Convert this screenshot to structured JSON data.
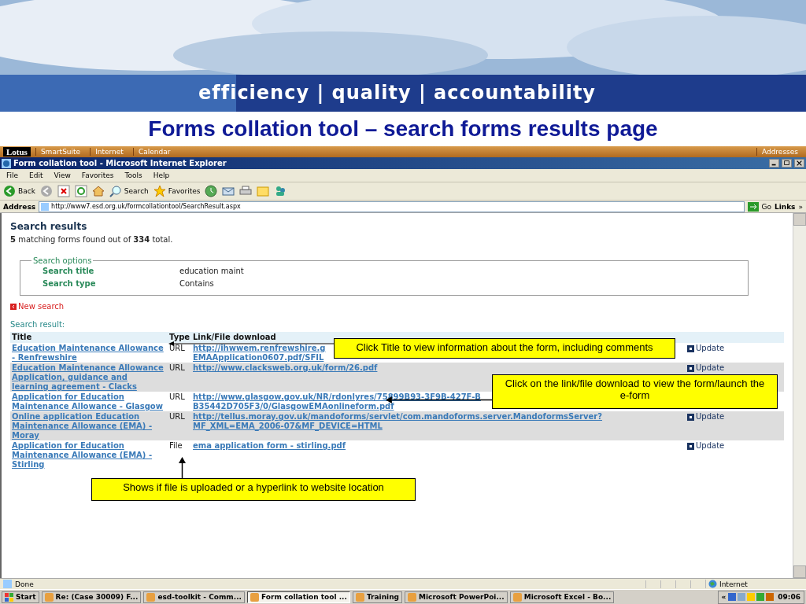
{
  "slide": {
    "tagline": "efficiency | quality | accountability",
    "title": "Forms collation tool – search forms results page"
  },
  "lotus_bar": {
    "brand": "Lotus",
    "items": [
      "SmartSuite",
      "Internet",
      "Calendar",
      "Addresses"
    ]
  },
  "window": {
    "title": "Form collation tool - Microsoft Internet Explorer"
  },
  "menu": [
    "File",
    "Edit",
    "View",
    "Favorites",
    "Tools",
    "Help"
  ],
  "toolbar": {
    "back": "Back",
    "search": "Search",
    "favorites": "Favorites"
  },
  "address_bar": {
    "label": "Address",
    "url": "http://www7.esd.org.uk/formcollationtool/SearchResult.aspx",
    "go": "Go",
    "links": "Links",
    "more": "»"
  },
  "page": {
    "heading": "Search results",
    "summary": "**5** matching forms found out of **334** total.",
    "options": {
      "legend": "Search options",
      "rows": [
        {
          "label": "Search title",
          "value": "education maint"
        },
        {
          "label": "Search type",
          "value": "Contains"
        }
      ]
    },
    "new_search": "New search",
    "result_label": "Search result:",
    "columns": [
      "Title",
      "Type",
      "Link/File download"
    ],
    "rows": [
      {
        "title": "Education Maintenance Allowance - Renfrewshire",
        "type": "URL",
        "link": [
          "http://ihwwem.renfrewshire.g",
          "EMAApplication0607.pdf/SFIL"
        ],
        "update": "Update"
      },
      {
        "title": "Education Maintenance Allowance Application, guidance and learning agreement - Clacks",
        "type": "URL",
        "link": [
          "http://www.clacksweb.org.uk/form/26.pdf"
        ],
        "update": "Update"
      },
      {
        "title": "Application for Education Maintenance Allowance - Glasgow",
        "type": "URL",
        "link": [
          "http://www.glasgow.gov.uk/NR/rdonlyres/75899B93-3F9B-427F-B",
          "B35442D705F3/0/GlasgowEMAonlineform.pdf"
        ],
        "update": ""
      },
      {
        "title": "Online application Education Maintenance Allowance (EMA) - Moray",
        "type": "URL",
        "link": [
          "http://tellus.moray.gov.uk/mandoforms/servlet/com.mandoforms.server.MandoformsServer?",
          "MF_XML=EMA_2006-07&MF_DEVICE=HTML"
        ],
        "update": "Update"
      },
      {
        "title": "Application for Education Maintenance Allowance (EMA) - Stirling",
        "type": "File",
        "link": [
          "ema application form - stirling.pdf"
        ],
        "update": "Update"
      }
    ],
    "callouts": [
      "Click Title to view information about the form, including comments",
      "Click on the link/file download to view the form/launch the e-form",
      "Shows if file is uploaded or a hyperlink to website location"
    ]
  },
  "status_bar": {
    "text": "Done",
    "zone": "Internet"
  },
  "taskbar": {
    "start": "Start",
    "items": [
      {
        "label": "Re: (Case 30009) F...",
        "selected": false
      },
      {
        "label": "esd-toolkit - Comm...",
        "selected": false
      },
      {
        "label": "Form collation tool ...",
        "selected": true
      },
      {
        "label": "Training",
        "selected": false
      },
      {
        "label": "Microsoft PowerPoi...",
        "selected": false
      },
      {
        "label": "Microsoft Excel - Bo...",
        "selected": false
      }
    ],
    "chevron": "«",
    "clock": "09:06"
  }
}
